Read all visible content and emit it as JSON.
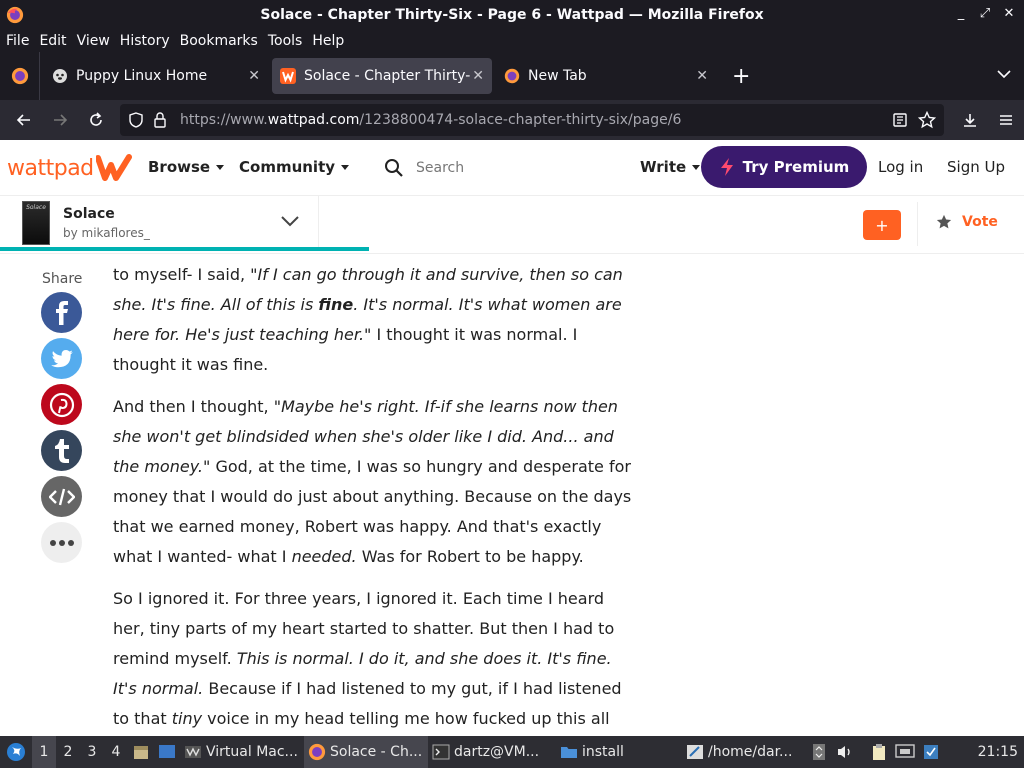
{
  "window": {
    "title": "Solace - Chapter Thirty-Six - Page 6 - Wattpad — Mozilla Firefox",
    "controls": [
      "_",
      "⤢",
      "✕"
    ]
  },
  "menu": [
    "File",
    "Edit",
    "View",
    "History",
    "Bookmarks",
    "Tools",
    "Help"
  ],
  "tabs": [
    {
      "label": "Puppy Linux Home",
      "active": false
    },
    {
      "label": "Solace - Chapter Thirty-Six",
      "active": true
    },
    {
      "label": "New Tab",
      "active": false
    }
  ],
  "urlbar": {
    "prefix": "https://www.",
    "domain": "wattpad.com",
    "path": "/1238800474-solace-chapter-thirty-six/page/6"
  },
  "header": {
    "logo": "wattpad",
    "browse": "Browse",
    "community": "Community",
    "search_placeholder": "Search",
    "write": "Write",
    "premium": "Try Premium",
    "login": "Log in",
    "signup": "Sign Up"
  },
  "story": {
    "cover_text": "Solace",
    "title": "Solace",
    "author": "by mikaflores_",
    "progress_fraction": 0.36,
    "add_label": "+",
    "vote": "Vote"
  },
  "share": {
    "label": "Share",
    "buttons": [
      {
        "name": "facebook",
        "color": "#3b5998"
      },
      {
        "name": "twitter",
        "color": "#55acee"
      },
      {
        "name": "pinterest",
        "color": "#bd081c"
      },
      {
        "name": "tumblr",
        "color": "#35465c"
      },
      {
        "name": "embed",
        "color": "#666666"
      },
      {
        "name": "more",
        "color": "#eeeeee"
      }
    ]
  },
  "content": {
    "p1": {
      "a": "to myself- I said, \"",
      "b": "If I can go through it and survive, then so can she. It's fine. All of this is ",
      "c": "fine",
      "d": ". It's normal. It's what women are here for. He's just teaching her.\"",
      "e": " I thought it was normal. I thought it was fine."
    },
    "p2": {
      "a": "And then I thought, \"",
      "b": "Maybe he's right. If-if she learns now then she won't get blindsided when she's older like I did. And... and the money.\"",
      "c": " God, at the time, I was so hungry and desperate for money that I would do just about anything. Because on the days that we earned money, Robert was happy. And that's exactly what I wanted- what I ",
      "d": "needed.",
      "e": " Was for Robert to be happy."
    },
    "p3": {
      "a": "So I ignored it. For three years, I ignored it. Each time I heard her, tiny parts of my heart started to shatter. But then I had to remind myself. ",
      "b": "This is normal. I do it, and she does it. It's fine. It's normal.",
      "c": " Because if I had listened to my gut, if I had listened to that ",
      "d": "tiny",
      "e": " voice in my head telling me how fucked up this all was, I would've lost it. I would've gone crazy."
    }
  },
  "taskbar": {
    "workspaces": [
      "1",
      "2",
      "3",
      "4"
    ],
    "tasks": [
      {
        "label": "Virtual Mac...",
        "active": false
      },
      {
        "label": "Solace - Ch...",
        "active": true
      },
      {
        "label": "dartz@VM...",
        "active": false
      },
      {
        "label": "install",
        "active": false
      },
      {
        "label": "/home/dar...",
        "active": false
      }
    ],
    "clock": "21:15"
  }
}
